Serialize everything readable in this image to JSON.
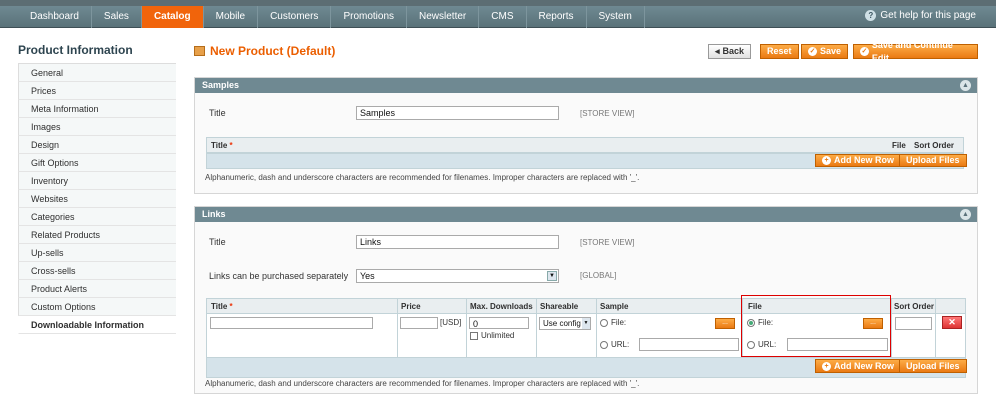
{
  "nav": {
    "items": [
      "Dashboard",
      "Sales",
      "Catalog",
      "Mobile",
      "Customers",
      "Promotions",
      "Newsletter",
      "CMS",
      "Reports",
      "System"
    ],
    "active": "Catalog",
    "help": "Get help for this page"
  },
  "sidebar": {
    "title": "Product Information",
    "items": [
      "General",
      "Prices",
      "Meta Information",
      "Images",
      "Design",
      "Gift Options",
      "Inventory",
      "Websites",
      "Categories",
      "Related Products",
      "Up-sells",
      "Cross-sells",
      "Product Alerts",
      "Custom Options",
      "Downloadable Information"
    ],
    "active": "Downloadable Information"
  },
  "header": {
    "title": "New Product (Default)",
    "back": "Back",
    "reset": "Reset",
    "save": "Save",
    "save_continue": "Save and Continue Edit"
  },
  "samples": {
    "legend": "Samples",
    "title_label": "Title",
    "title_value": "Samples",
    "scope": "[STORE VIEW]",
    "col_title": "Title",
    "col_file": "File",
    "col_sort": "Sort Order",
    "add_row": "Add New Row",
    "upload": "Upload Files",
    "note": "Alphanumeric, dash and underscore characters are recommended for filenames. Improper characters are replaced with '_'."
  },
  "links": {
    "legend": "Links",
    "title_label": "Title",
    "title_value": "Links",
    "scope": "[STORE VIEW]",
    "separate_label": "Links can be purchased separately",
    "separate_value": "Yes",
    "separate_scope": "[GLOBAL]",
    "col_title": "Title",
    "col_price": "Price",
    "col_maxdl": "Max. Downloads",
    "col_share": "Shareable",
    "col_sample": "Sample",
    "col_file": "File",
    "col_sort": "Sort Order",
    "currency": "[USD]",
    "maxdl_value": "0",
    "unlimited": "Unlimited",
    "share_value": "Use config",
    "file_label": "File:",
    "url_label": "URL:",
    "browse": "...",
    "add_row": "Add New Row",
    "upload": "Upload Files",
    "note": "Alphanumeric, dash and underscore characters are recommended for filenames. Improper characters are replaced with '_'."
  }
}
